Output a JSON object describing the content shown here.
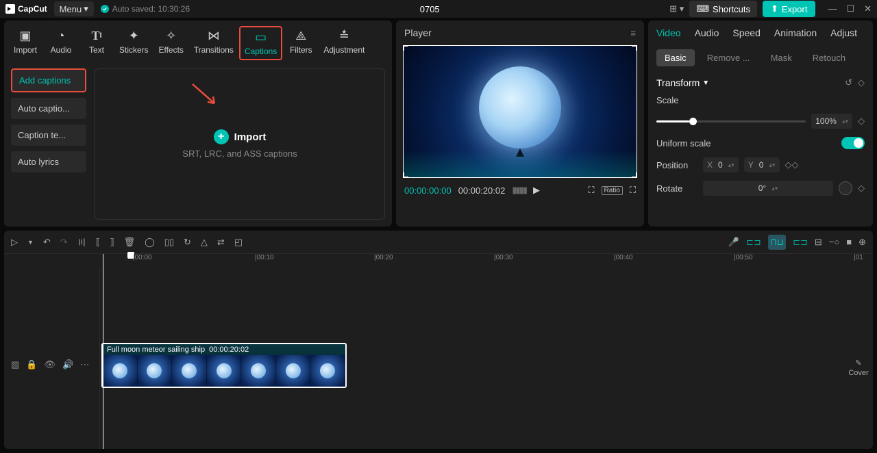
{
  "app": {
    "name": "CapCut",
    "menu": "Menu",
    "autosave": "Auto saved: 10:30:26",
    "project": "0705"
  },
  "titlebar": {
    "shortcuts": "Shortcuts",
    "export": "Export"
  },
  "mediaTabs": {
    "import": "Import",
    "audio": "Audio",
    "text": "Text",
    "stickers": "Stickers",
    "effects": "Effects",
    "transitions": "Transitions",
    "captions": "Captions",
    "filters": "Filters",
    "adjustment": "Adjustment"
  },
  "sidebar": {
    "addCaptions": "Add captions",
    "autoCaptions": "Auto captio...",
    "captionTemplates": "Caption te...",
    "autoLyrics": "Auto lyrics"
  },
  "import": {
    "title": "Import",
    "subtitle": "SRT, LRC, and ASS captions"
  },
  "player": {
    "title": "Player",
    "current": "00:00:00:00",
    "duration": "00:00:20:02",
    "ratio": "Ratio"
  },
  "props": {
    "tabs": {
      "video": "Video",
      "audio": "Audio",
      "speed": "Speed",
      "animation": "Animation",
      "adjust": "Adjust"
    },
    "subtabs": {
      "basic": "Basic",
      "remove": "Remove ...",
      "mask": "Mask",
      "retouch": "Retouch"
    },
    "transform": "Transform",
    "scale": "Scale",
    "scaleValue": "100%",
    "uniform": "Uniform scale",
    "position": "Position",
    "posX": "X",
    "posXVal": "0",
    "posY": "Y",
    "posYVal": "0",
    "rotate": "Rotate",
    "rotateVal": "0°"
  },
  "timeline": {
    "ticks": [
      "|00:00",
      "|00:10",
      "|00:20",
      "|00:30",
      "|00:40",
      "|00:50",
      "|01"
    ],
    "cover": "Cover",
    "clip": {
      "name": "Full moon meteor sailing ship",
      "duration": "00:00:20:02"
    }
  }
}
